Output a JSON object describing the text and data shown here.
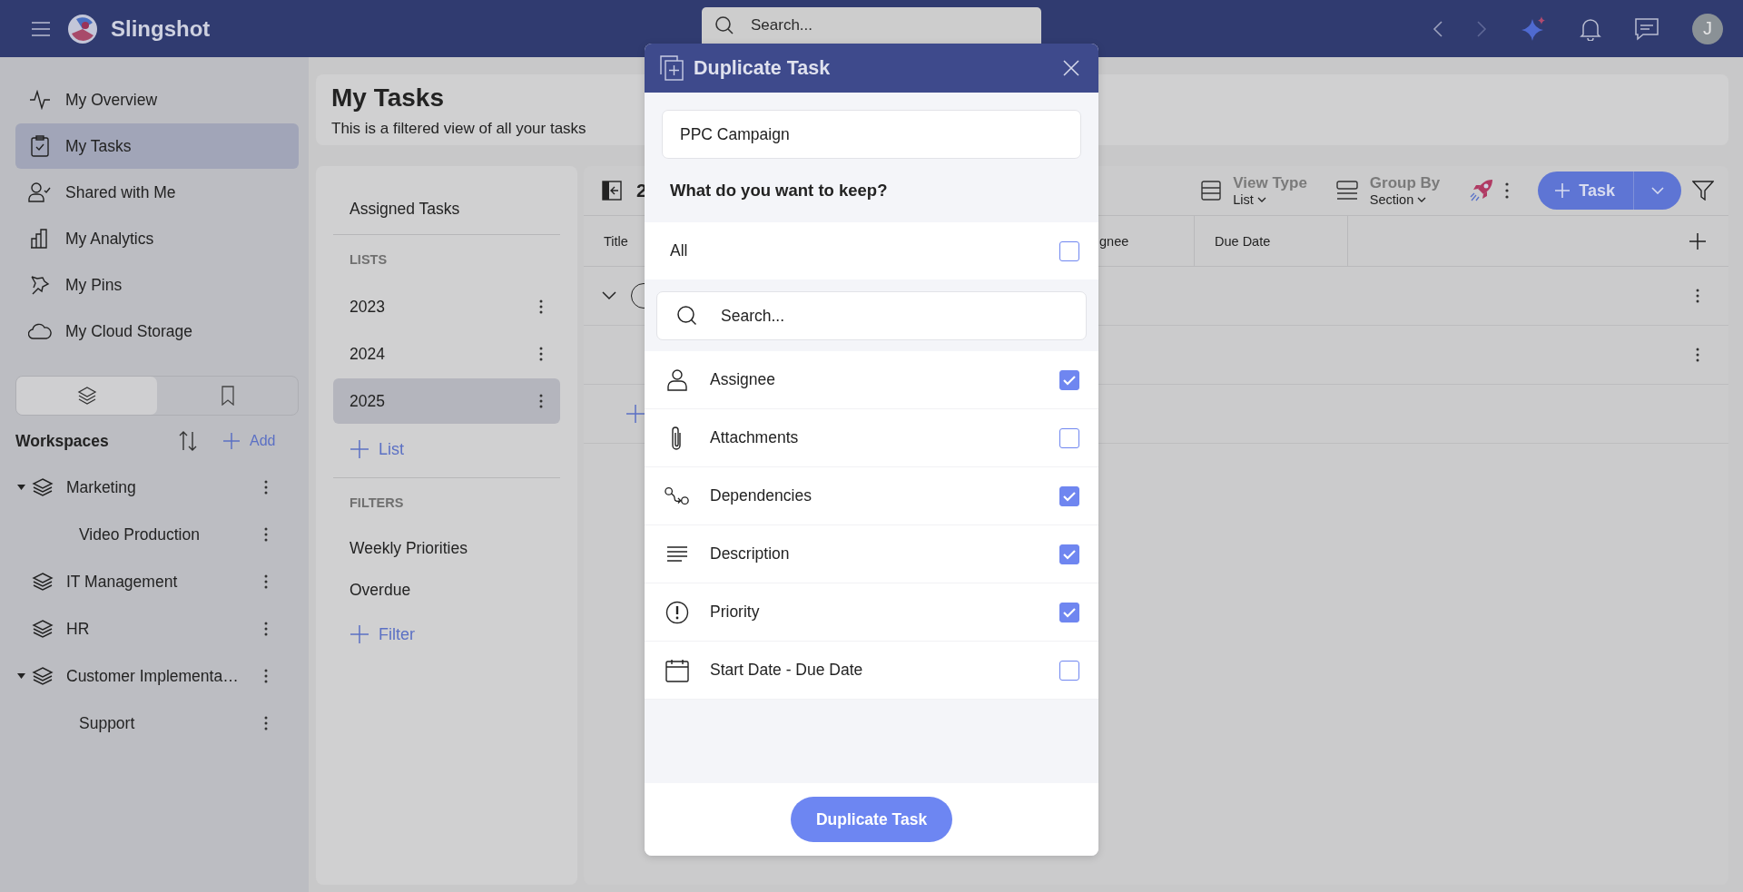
{
  "app": {
    "name": "Slingshot",
    "search_placeholder": "Search...",
    "avatar": "J"
  },
  "nav": [
    {
      "label": "My Overview",
      "selected": false
    },
    {
      "label": "My Tasks",
      "selected": true
    },
    {
      "label": "Shared with Me",
      "selected": false
    },
    {
      "label": "My Analytics",
      "selected": false
    },
    {
      "label": "My Pins",
      "selected": false
    },
    {
      "label": "My Cloud Storage",
      "selected": false
    }
  ],
  "sidebar_tabs": [
    {
      "selected": true
    },
    {
      "selected": false
    }
  ],
  "workspaces": {
    "title": "Workspaces",
    "add": "Add",
    "items": [
      {
        "label": "Marketing",
        "expanded": true,
        "children": [
          {
            "label": "Video Production"
          }
        ]
      },
      {
        "label": "IT Management",
        "expanded": false
      },
      {
        "label": "HR",
        "expanded": false
      },
      {
        "label": "Customer Implementa…",
        "expanded": true,
        "children": [
          {
            "label": "Support"
          }
        ]
      }
    ]
  },
  "page": {
    "title": "My Tasks",
    "subtitle": "This is a filtered view of all your tasks"
  },
  "lists_panel": {
    "assigned": "Assigned Tasks",
    "lists_heading": "LISTS",
    "lists": [
      {
        "label": "2023",
        "selected": false
      },
      {
        "label": "2024",
        "selected": false
      },
      {
        "label": "2025",
        "selected": true
      }
    ],
    "add_list": "List",
    "filters_heading": "FILTERS",
    "filters": [
      "Weekly Priorities",
      "Overdue"
    ],
    "add_filter": "Filter"
  },
  "table": {
    "list_name": "2",
    "view_type": {
      "label": "View Type",
      "value": "List"
    },
    "group_by": {
      "label": "Group By",
      "value": "Section"
    },
    "task_button": "Task",
    "columns": [
      "Title",
      "gnee",
      "Due Date"
    ],
    "rows": [
      {
        "kind": "section",
        "expanded": true
      },
      {
        "kind": "task"
      },
      {
        "kind": "add"
      }
    ]
  },
  "dialog": {
    "title": "Duplicate Task",
    "name_value": "PPC Campaign",
    "question": "What do you want to keep?",
    "all": {
      "label": "All",
      "checked": false
    },
    "search_placeholder": "Search...",
    "options": [
      {
        "label": "Assignee",
        "checked": true
      },
      {
        "label": "Attachments",
        "checked": false
      },
      {
        "label": "Dependencies",
        "checked": true
      },
      {
        "label": "Description",
        "checked": true
      },
      {
        "label": "Priority",
        "checked": true
      },
      {
        "label": "Start Date - Due Date",
        "checked": false
      }
    ],
    "submit": "Duplicate Task"
  }
}
